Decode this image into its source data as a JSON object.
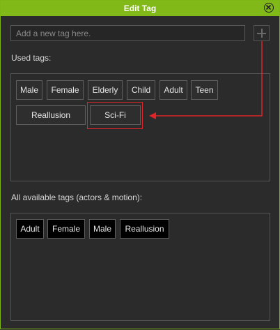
{
  "window": {
    "title": "Edit Tag"
  },
  "input": {
    "placeholder": "Add a new tag here."
  },
  "used_tags": {
    "label": "Used tags:",
    "items": [
      "Male",
      "Female",
      "Elderly",
      "Child",
      "Adult",
      "Teen",
      "Reallusion",
      "Sci-Fi"
    ]
  },
  "available_tags": {
    "label": "All available tags (actors & motion):",
    "items": [
      "Adult",
      "Female",
      "Male",
      "Reallusion"
    ]
  },
  "colors": {
    "title_bar": "#80b918",
    "background": "#2b2b2b",
    "highlight": "#e0252a"
  }
}
